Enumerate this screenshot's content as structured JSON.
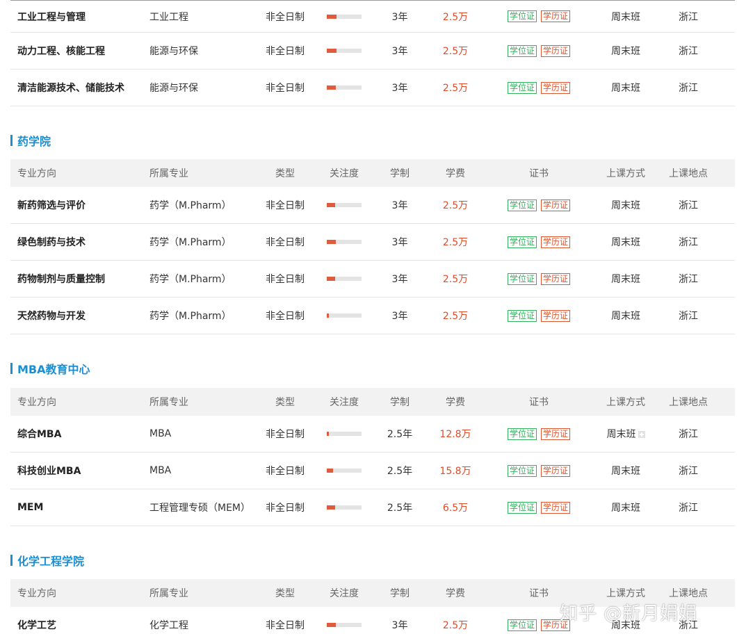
{
  "columns": {
    "direction": "专业方向",
    "major": "所属专业",
    "type": "类型",
    "attention": "关注度",
    "duration": "学制",
    "fee": "学费",
    "certificate": "证书",
    "mode": "上课方式",
    "location": "上课地点"
  },
  "badges": {
    "degree": "学位证",
    "diploma": "学历证"
  },
  "colors": {
    "accent": "#1a8fd1",
    "fee": "#e04b2a",
    "degree_badge": "#33b25c",
    "diploma_badge": "#e0562f",
    "bar": "#e05a3d"
  },
  "sections": [
    {
      "title": "",
      "rows": [
        {
          "direction": "工业工程与管理",
          "major": "工业工程",
          "type": "非全日制",
          "attention": 0.28,
          "duration": "3年",
          "fee": "2.5万",
          "mode": "周末班",
          "location": "浙江"
        },
        {
          "direction": "动力工程、核能工程",
          "major": "能源与环保",
          "type": "非全日制",
          "attention": 0.28,
          "duration": "3年",
          "fee": "2.5万",
          "mode": "周末班",
          "location": "浙江"
        },
        {
          "direction": "清洁能源技术、储能技术",
          "major": "能源与环保",
          "type": "非全日制",
          "attention": 0.26,
          "duration": "3年",
          "fee": "2.5万",
          "mode": "周末班",
          "location": "浙江"
        }
      ]
    },
    {
      "title": "药学院",
      "rows": [
        {
          "direction": "新药筛选与评价",
          "major": "药学（M.Pharm）",
          "type": "非全日制",
          "attention": 0.24,
          "duration": "3年",
          "fee": "2.5万",
          "mode": "周末班",
          "location": "浙江"
        },
        {
          "direction": "绿色制药与技术",
          "major": "药学（M.Pharm）",
          "type": "非全日制",
          "attention": 0.26,
          "duration": "3年",
          "fee": "2.5万",
          "mode": "周末班",
          "location": "浙江"
        },
        {
          "direction": "药物制剂与质量控制",
          "major": "药学（M.Pharm）",
          "type": "非全日制",
          "attention": 0.24,
          "duration": "3年",
          "fee": "2.5万",
          "mode": "周末班",
          "location": "浙江"
        },
        {
          "direction": "天然药物与开发",
          "major": "药学（M.Pharm）",
          "type": "非全日制",
          "attention": 0.06,
          "duration": "3年",
          "fee": "2.5万",
          "mode": "周末班",
          "location": "浙江"
        }
      ]
    },
    {
      "title": "MBA教育中心",
      "rows": [
        {
          "direction": "综合MBA",
          "major": "MBA",
          "type": "非全日制",
          "attention": 0.06,
          "duration": "2.5年",
          "fee": "12.8万",
          "mode": "周末班",
          "location": "浙江",
          "mode_icon": "plus-icon"
        },
        {
          "direction": "科技创业MBA",
          "major": "MBA",
          "type": "非全日制",
          "attention": 0.18,
          "duration": "2.5年",
          "fee": "15.8万",
          "mode": "周末班",
          "location": "浙江"
        },
        {
          "direction": "MEM",
          "major": "工程管理专硕（MEM）",
          "type": "非全日制",
          "attention": 0.24,
          "duration": "2.5年",
          "fee": "6.5万",
          "mode": "周末班",
          "location": "浙江"
        }
      ]
    },
    {
      "title": "化学工程学院",
      "rows": [
        {
          "direction": "化学工艺",
          "major": "化学工程",
          "type": "非全日制",
          "attention": 0.26,
          "duration": "3年",
          "fee": "2.5万",
          "mode": "周末班",
          "location": "浙江"
        }
      ]
    }
  ],
  "watermark": "知乎 @新月娟娟"
}
